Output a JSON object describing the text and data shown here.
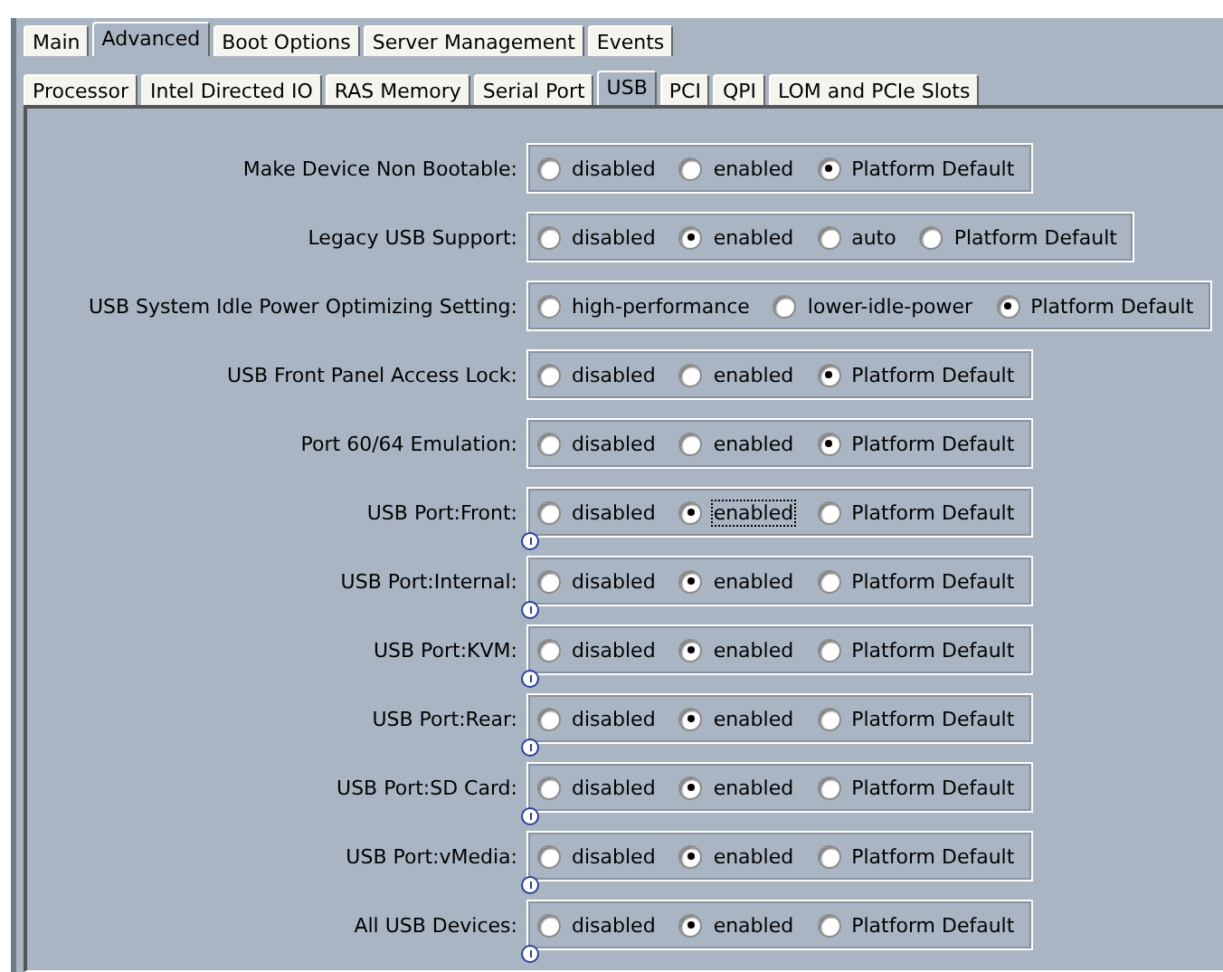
{
  "tabs": [
    {
      "label": "Main",
      "selected": false
    },
    {
      "label": "Advanced",
      "selected": true
    },
    {
      "label": "Boot Options",
      "selected": false
    },
    {
      "label": "Server Management",
      "selected": false
    },
    {
      "label": "Events",
      "selected": false
    }
  ],
  "subtabs": [
    {
      "label": "Processor",
      "selected": false
    },
    {
      "label": "Intel Directed IO",
      "selected": false
    },
    {
      "label": "RAS Memory",
      "selected": false
    },
    {
      "label": "Serial Port",
      "selected": false
    },
    {
      "label": "USB",
      "selected": true
    },
    {
      "label": "PCI",
      "selected": false
    },
    {
      "label": "QPI",
      "selected": false
    },
    {
      "label": "LOM and PCIe Slots",
      "selected": false
    }
  ],
  "settings": [
    {
      "label": "Make Device Non Bootable:",
      "resize_handle": false,
      "options": [
        {
          "label": "disabled",
          "selected": false,
          "focused": false
        },
        {
          "label": "enabled",
          "selected": false,
          "focused": false
        },
        {
          "label": "Platform Default",
          "selected": true,
          "focused": false
        }
      ]
    },
    {
      "label": "Legacy USB Support:",
      "resize_handle": false,
      "options": [
        {
          "label": "disabled",
          "selected": false,
          "focused": false
        },
        {
          "label": "enabled",
          "selected": true,
          "focused": false
        },
        {
          "label": "auto",
          "selected": false,
          "focused": false
        },
        {
          "label": "Platform Default",
          "selected": false,
          "focused": false
        }
      ]
    },
    {
      "label": "USB System Idle Power Optimizing Setting:",
      "resize_handle": false,
      "options": [
        {
          "label": "high-performance",
          "selected": false,
          "focused": false
        },
        {
          "label": "lower-idle-power",
          "selected": false,
          "focused": false
        },
        {
          "label": "Platform Default",
          "selected": true,
          "focused": false
        }
      ]
    },
    {
      "label": "USB Front Panel Access Lock:",
      "resize_handle": false,
      "options": [
        {
          "label": "disabled",
          "selected": false,
          "focused": false
        },
        {
          "label": "enabled",
          "selected": false,
          "focused": false
        },
        {
          "label": "Platform Default",
          "selected": true,
          "focused": false
        }
      ]
    },
    {
      "label": "Port 60/64 Emulation:",
      "resize_handle": false,
      "options": [
        {
          "label": "disabled",
          "selected": false,
          "focused": false
        },
        {
          "label": "enabled",
          "selected": false,
          "focused": false
        },
        {
          "label": "Platform Default",
          "selected": true,
          "focused": false
        }
      ]
    },
    {
      "label": "USB Port:Front:",
      "resize_handle": true,
      "options": [
        {
          "label": "disabled",
          "selected": false,
          "focused": false
        },
        {
          "label": "enabled",
          "selected": true,
          "focused": true
        },
        {
          "label": "Platform Default",
          "selected": false,
          "focused": false
        }
      ]
    },
    {
      "label": "USB Port:Internal:",
      "resize_handle": true,
      "options": [
        {
          "label": "disabled",
          "selected": false,
          "focused": false
        },
        {
          "label": "enabled",
          "selected": true,
          "focused": false
        },
        {
          "label": "Platform Default",
          "selected": false,
          "focused": false
        }
      ]
    },
    {
      "label": "USB Port:KVM:",
      "resize_handle": true,
      "options": [
        {
          "label": "disabled",
          "selected": false,
          "focused": false
        },
        {
          "label": "enabled",
          "selected": true,
          "focused": false
        },
        {
          "label": "Platform Default",
          "selected": false,
          "focused": false
        }
      ]
    },
    {
      "label": "USB Port:Rear:",
      "resize_handle": true,
      "options": [
        {
          "label": "disabled",
          "selected": false,
          "focused": false
        },
        {
          "label": "enabled",
          "selected": true,
          "focused": false
        },
        {
          "label": "Platform Default",
          "selected": false,
          "focused": false
        }
      ]
    },
    {
      "label": "USB Port:SD Card:",
      "resize_handle": true,
      "options": [
        {
          "label": "disabled",
          "selected": false,
          "focused": false
        },
        {
          "label": "enabled",
          "selected": true,
          "focused": false
        },
        {
          "label": "Platform Default",
          "selected": false,
          "focused": false
        }
      ]
    },
    {
      "label": "USB Port:vMedia:",
      "resize_handle": true,
      "options": [
        {
          "label": "disabled",
          "selected": false,
          "focused": false
        },
        {
          "label": "enabled",
          "selected": true,
          "focused": false
        },
        {
          "label": "Platform Default",
          "selected": false,
          "focused": false
        }
      ]
    },
    {
      "label": "All USB Devices:",
      "resize_handle": true,
      "options": [
        {
          "label": "disabled",
          "selected": false,
          "focused": false
        },
        {
          "label": "enabled",
          "selected": true,
          "focused": false
        },
        {
          "label": "Platform Default",
          "selected": false,
          "focused": false
        }
      ]
    }
  ]
}
